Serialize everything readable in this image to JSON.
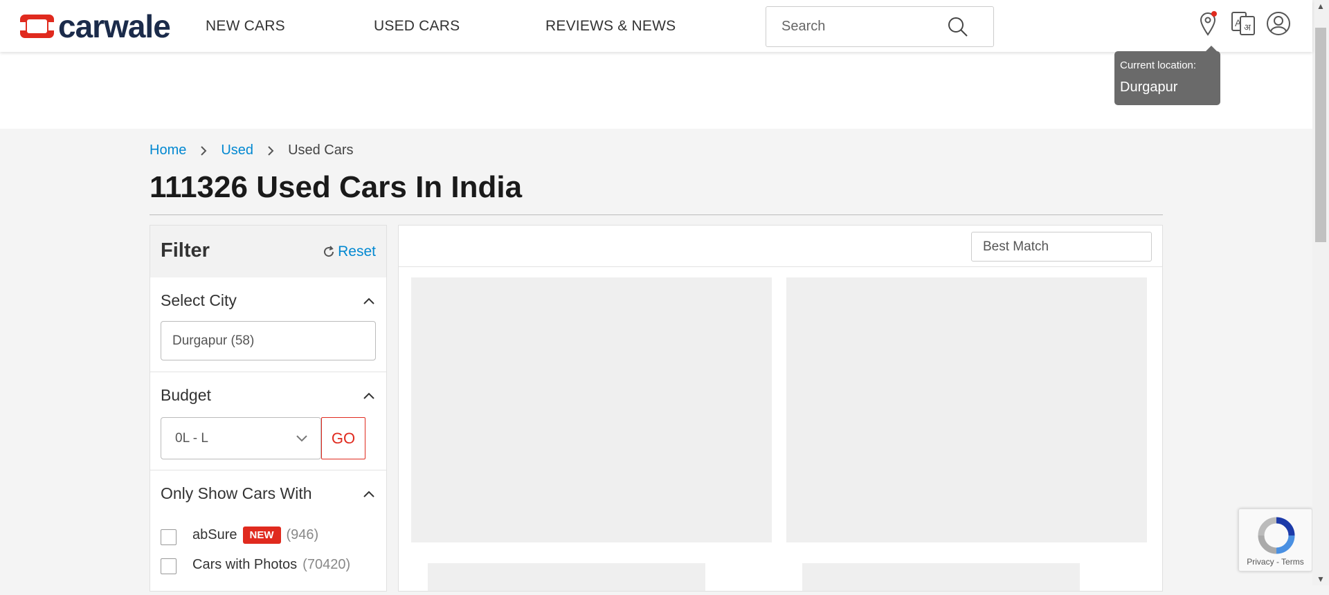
{
  "header": {
    "logo_text": "carwale",
    "nav": [
      "NEW CARS",
      "USED CARS",
      "REVIEWS & NEWS"
    ],
    "search_placeholder": "Search"
  },
  "location_tip": {
    "label": "Current location:",
    "city": "Durgapur"
  },
  "breadcrumb": {
    "home": "Home",
    "used": "Used",
    "current": "Used Cars",
    "sep": ">"
  },
  "page_title": "111326 Used Cars In India",
  "filter": {
    "title": "Filter",
    "reset": "Reset",
    "city": {
      "heading": "Select City",
      "value": "Durgapur (58)"
    },
    "budget": {
      "heading": "Budget",
      "value": "0L - L",
      "go": "GO"
    },
    "only_show": {
      "heading": "Only Show Cars With",
      "options": [
        {
          "label": "abSure",
          "badge": "NEW",
          "count": "(946)"
        },
        {
          "label": "Cars with Photos",
          "count": "(70420)"
        }
      ]
    }
  },
  "sort": {
    "value": "Best Match"
  },
  "recaptcha": {
    "links": "Privacy - Terms"
  },
  "colors": {
    "brand_red": "#e02a1e",
    "link_blue": "#0288d1",
    "navy": "#1b2b4a"
  }
}
